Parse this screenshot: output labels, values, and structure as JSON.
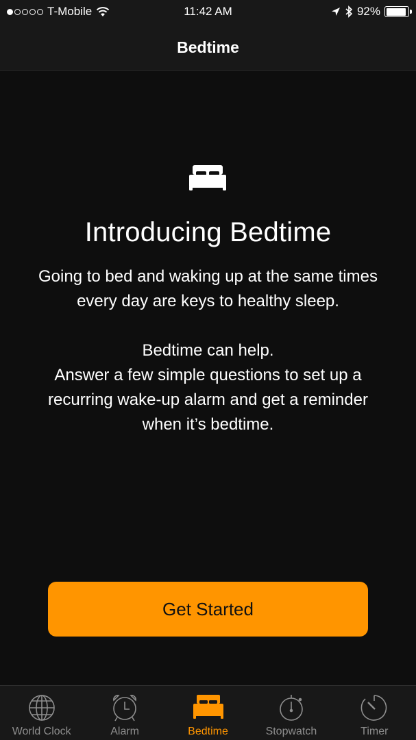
{
  "status_bar": {
    "signal_bars_filled": 1,
    "signal_bars_total": 5,
    "carrier": "T-Mobile",
    "time": "11:42 AM",
    "battery_percent": "92%",
    "battery_level": 0.92,
    "icons": [
      "wifi-icon",
      "location-arrow-icon",
      "bluetooth-icon",
      "battery-icon"
    ]
  },
  "nav": {
    "title": "Bedtime"
  },
  "main": {
    "icon": "bed-icon",
    "headline": "Introducing Bedtime",
    "paragraph1_line1": "Going to bed and waking up at the same times",
    "paragraph1_line2": "every day are keys to healthy sleep.",
    "paragraph2_line1": "Bedtime can help.",
    "paragraph2_line2": "Answer a few simple questions to set up a",
    "paragraph2_line3": "recurring wake-up alarm and get a reminder",
    "paragraph2_line4": "when it’s bedtime.",
    "cta_label": "Get Started"
  },
  "tabs": [
    {
      "label": "World Clock",
      "icon": "globe-icon",
      "active": false
    },
    {
      "label": "Alarm",
      "icon": "alarm-clock-icon",
      "active": false
    },
    {
      "label": "Bedtime",
      "icon": "bed-icon",
      "active": true
    },
    {
      "label": "Stopwatch",
      "icon": "stopwatch-icon",
      "active": false
    },
    {
      "label": "Timer",
      "icon": "timer-icon",
      "active": false
    }
  ],
  "colors": {
    "accent": "#ff9500",
    "inactive_tab": "#8e8e8e",
    "background": "#0e0e0e",
    "bar_background": "#181818"
  }
}
